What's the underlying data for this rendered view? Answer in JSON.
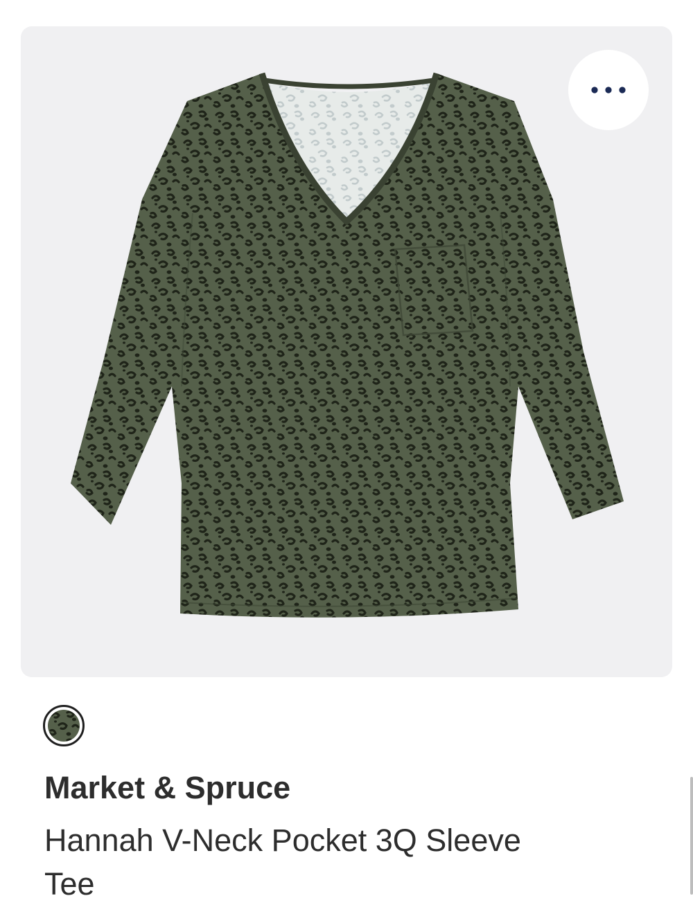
{
  "product": {
    "image_alt": "Green leopard print v-neck three-quarter sleeve tee",
    "more_options_icon": "more-horizontal-icon",
    "swatch_color": "#55604a",
    "brand": "Market & Spruce",
    "name": "Hannah V-Neck Pocket 3Q Sleeve Tee"
  },
  "colors": {
    "background": "#ffffff",
    "card": "#f0f0f2",
    "dots": "#1b2a55",
    "shirt": "#55604a",
    "spots": "#1f2419"
  }
}
